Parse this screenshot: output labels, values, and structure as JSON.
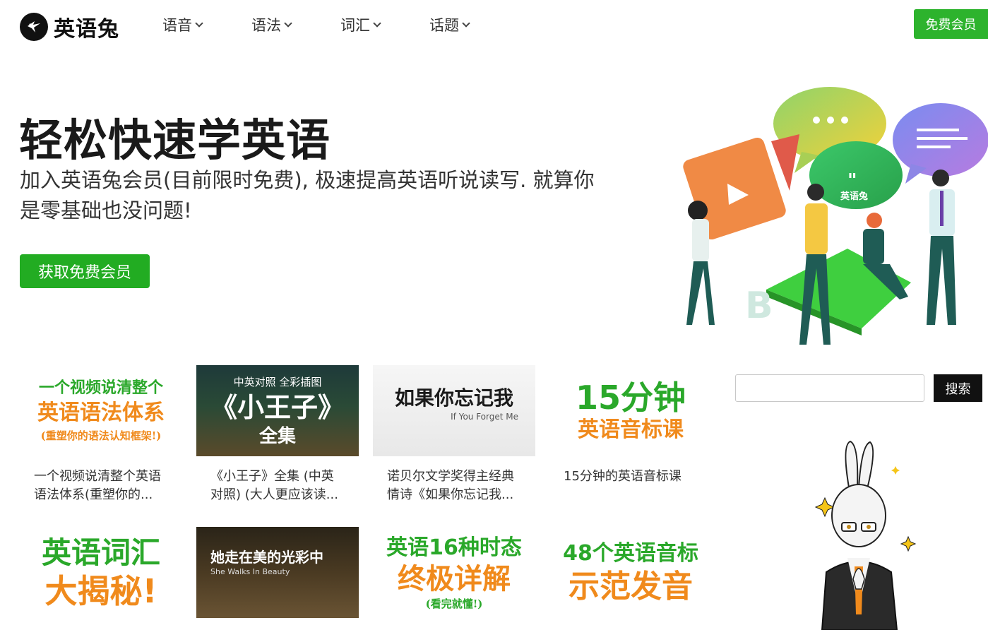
{
  "header": {
    "logo_text": "英语兔",
    "nav": [
      {
        "label": "语音"
      },
      {
        "label": "语法"
      },
      {
        "label": "词汇"
      },
      {
        "label": "话题"
      }
    ],
    "vip_button": "免费会员"
  },
  "hero": {
    "title": "轻松快速学英语",
    "subtitle": "加入英语兔会员(目前限时免费), 极速提高英语听说读写. 就算你是零基础也没问题!",
    "cta_button": "获取免费会员",
    "illustration_label": "英语兔"
  },
  "courses": [
    {
      "thumb_lines": [
        "一个视频说清整个",
        "英语语法体系",
        "(重塑你的语法认知框架!)"
      ],
      "title": "一个视频说清整个英语语法体系(重塑你的..."
    },
    {
      "thumb_lines": [
        "中英对照 全彩插图",
        "《小王子》",
        "全集"
      ],
      "title": "《小王子》全集 (中英对照) (大人更应该读..."
    },
    {
      "thumb_lines": [
        "如果你忘记我",
        "If You Forget Me"
      ],
      "title": "诺贝尔文学奖得主经典情诗《如果你忘记我..."
    },
    {
      "thumb_lines": [
        "15分钟",
        "英语音标课"
      ],
      "title": "15分钟的英语音标课"
    },
    {
      "thumb_lines": [
        "英语词汇",
        "大揭秘!"
      ]
    },
    {
      "thumb_lines": [
        "她走在美的光彩中",
        "She Walks In Beauty"
      ]
    },
    {
      "thumb_lines": [
        "英语16种时态",
        "终极详解",
        "(看完就懂!)"
      ]
    },
    {
      "thumb_lines": [
        "48个英语音标",
        "示范发音"
      ]
    }
  ],
  "search": {
    "placeholder": "",
    "button": "搜索"
  },
  "colors": {
    "brand_green": "#2db32d",
    "accent_orange": "#f08a1c",
    "text_dark": "#1a1a1a"
  }
}
